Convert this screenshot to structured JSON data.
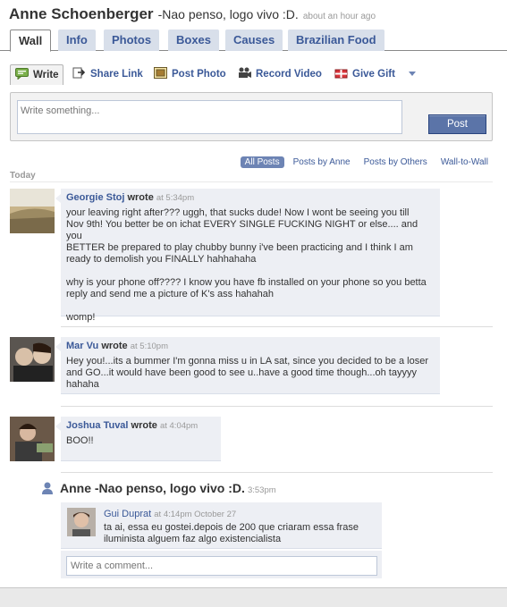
{
  "profile": {
    "name": "Anne Schoenberger",
    "status": "-Nao penso, logo vivo :D.",
    "status_time": "about an hour ago"
  },
  "tabs": [
    {
      "label": "Wall"
    },
    {
      "label": "Info"
    },
    {
      "label": "Photos"
    },
    {
      "label": "Boxes"
    },
    {
      "label": "Causes"
    },
    {
      "label": "Brazilian Food"
    }
  ],
  "publisher": {
    "buttons": {
      "write": "Write",
      "share_link": "Share Link",
      "post_photo": "Post Photo",
      "record_video": "Record Video",
      "give_gift": "Give Gift"
    },
    "input_placeholder": "Write something...",
    "post_label": "Post"
  },
  "filters": [
    "All Posts",
    "Posts by Anne",
    "Posts by Others",
    "Wall-to-Wall"
  ],
  "day_label": "Today",
  "posts": [
    {
      "author": "Georgie Stoj",
      "verb": "wrote",
      "time": "at 5:34pm",
      "text": "your leaving right after??? uggh, that sucks dude! Now I wont be seeing you till\nNov 9th! You better be on ichat EVERY SINGLE FUCKING NIGHT or else.... and you\nBETTER be prepared to play chubby bunny i've been practicing and I think I am\nready to demolish you FINALLY hahhahaha\n\nwhy is your phone off???? I know you have fb installed on your phone so you betta\nreply and send me a picture of K's ass hahahah\n\nwomp!"
    },
    {
      "author": "Mar Vu",
      "verb": "wrote",
      "time": "at 5:10pm",
      "text": "Hey you!...its a bummer I'm gonna miss u in LA sat, since you decided to be a loser\nand GO...it would have been good to see u..have a good time though...oh tayyyy\nhahaha"
    },
    {
      "author": "Joshua Tuval",
      "verb": "wrote",
      "time": "at 4:04pm",
      "text": "BOO!!"
    }
  ],
  "status_post": {
    "text": "Anne -Nao penso, logo vivo :D.",
    "time": "3:53pm",
    "comment": {
      "author": "Gui Duprat",
      "meta": "at 4:14pm October 27",
      "text": "ta ai, essa eu gostei.depois de 200 que criaram essa frase iluminista alguem faz algo existencialista"
    },
    "comment_placeholder": "Write a comment..."
  }
}
